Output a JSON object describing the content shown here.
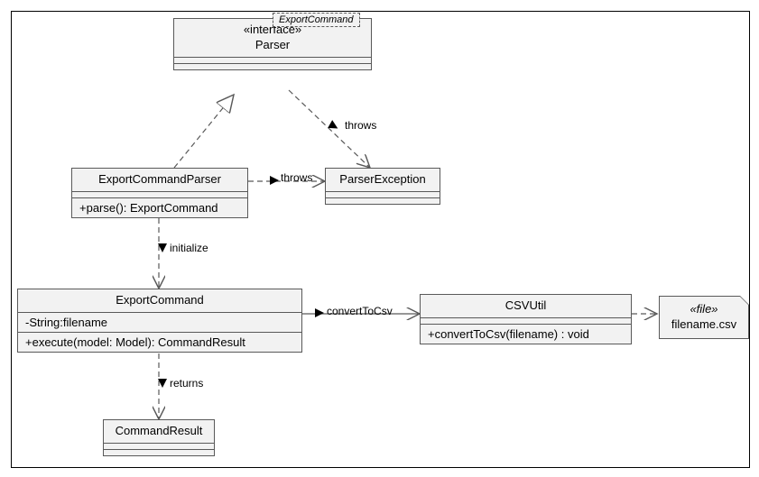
{
  "parser": {
    "stereotype": "«interface»",
    "name": "Parser",
    "generic": "ExportCommand"
  },
  "exportCommandParser": {
    "name": "ExportCommandParser",
    "op": "+parse(): ExportCommand"
  },
  "parserException": {
    "name": "ParserException"
  },
  "exportCommand": {
    "name": "ExportCommand",
    "attr": "-String:filename",
    "op": "+execute(model: Model): CommandResult"
  },
  "csvUtil": {
    "name": "CSVUtil",
    "op": "+convertToCsv(filename) : void"
  },
  "commandResult": {
    "name": "CommandResult"
  },
  "fileNote": {
    "stereotype": "«file»",
    "name": "filename.csv"
  },
  "labels": {
    "throws1": "throws",
    "throws2": "throws",
    "initialize": "initialize",
    "convertToCsv": "convertToCsv",
    "returns": "returns"
  },
  "chart_data": {
    "type": "uml_class_diagram",
    "classes": [
      {
        "name": "Parser",
        "stereotype": "interface",
        "generic_param": "ExportCommand"
      },
      {
        "name": "ExportCommandParser",
        "operations": [
          "+parse(): ExportCommand"
        ]
      },
      {
        "name": "ParserException"
      },
      {
        "name": "ExportCommand",
        "attributes": [
          "-String:filename"
        ],
        "operations": [
          "+execute(model: Model): CommandResult"
        ]
      },
      {
        "name": "CSVUtil",
        "operations": [
          "+convertToCsv(filename) : void"
        ]
      },
      {
        "name": "CommandResult"
      }
    ],
    "artifacts": [
      {
        "name": "filename.csv",
        "stereotype": "file"
      }
    ],
    "relationships": [
      {
        "from": "ExportCommandParser",
        "to": "Parser",
        "type": "realization"
      },
      {
        "from": "Parser",
        "to": "ParserException",
        "type": "dependency",
        "label": "throws"
      },
      {
        "from": "ExportCommandParser",
        "to": "ParserException",
        "type": "dependency",
        "label": "throws"
      },
      {
        "from": "ExportCommandParser",
        "to": "ExportCommand",
        "type": "dependency",
        "label": "initialize"
      },
      {
        "from": "ExportCommand",
        "to": "CSVUtil",
        "type": "association",
        "label": "convertToCsv"
      },
      {
        "from": "ExportCommand",
        "to": "CommandResult",
        "type": "dependency",
        "label": "returns"
      },
      {
        "from": "CSVUtil",
        "to": "filename.csv",
        "type": "dependency"
      }
    ]
  }
}
